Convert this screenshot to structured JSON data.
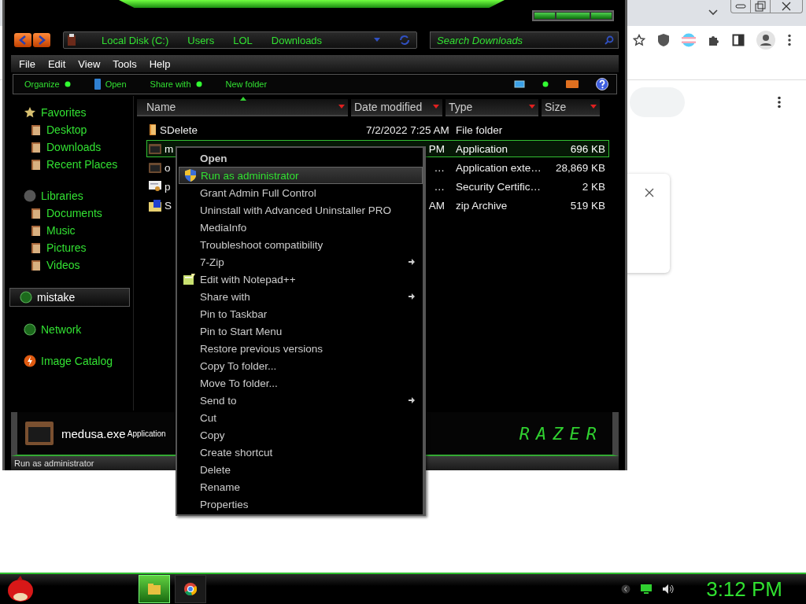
{
  "explorer": {
    "address_bar": {
      "crumbs": [
        "Local Disk (C:)",
        "Users",
        "LOL",
        "Downloads"
      ]
    },
    "search": {
      "placeholder": "Search Downloads"
    },
    "menu_bar": [
      "File",
      "Edit",
      "View",
      "Tools",
      "Help"
    ],
    "toolbar": [
      {
        "label": "Organize",
        "kind": "dropdown"
      },
      {
        "label": "Open",
        "kind": "icon"
      },
      {
        "label": "Share with",
        "kind": "dropdown"
      },
      {
        "label": "New folder",
        "kind": "plain"
      }
    ],
    "sidebar": {
      "items": [
        {
          "label": "Favorites",
          "kind": "star",
          "selected": false,
          "children": [
            {
              "label": "Desktop",
              "kind": "folder",
              "selected": false
            },
            {
              "label": "Downloads",
              "kind": "folder",
              "selected": false
            },
            {
              "label": "Recent Places",
              "kind": "folder",
              "selected": false
            }
          ]
        },
        {
          "label": "Libraries",
          "kind": "disc",
          "selected": false,
          "children": [
            {
              "label": "Documents",
              "kind": "folder",
              "selected": false
            },
            {
              "label": "Music",
              "kind": "folder",
              "selected": false
            },
            {
              "label": "Pictures",
              "kind": "folder",
              "selected": false
            },
            {
              "label": "Videos",
              "kind": "folder",
              "selected": false
            }
          ]
        },
        {
          "label": "mistake",
          "kind": "sphere",
          "selected": true
        },
        {
          "label": "Network",
          "kind": "sphere",
          "selected": false
        },
        {
          "label": "Image Catalog",
          "kind": "bolt",
          "selected": false
        }
      ]
    },
    "columns": [
      "Name",
      "Date modified",
      "Type",
      "Size"
    ],
    "rows": [
      {
        "name": "SDelete",
        "date": "7/2/2022 7:25 AM",
        "type": "File folder",
        "kind": "folder",
        "selected": false
      },
      {
        "name": "m",
        "date": "PM",
        "type": "Application",
        "size": "696 KB",
        "kind": "app",
        "selected": true
      },
      {
        "name": "o",
        "date": "…",
        "type": "Application exte…",
        "size": "28,869 KB",
        "kind": "app",
        "selected": false
      },
      {
        "name": "p",
        "date": "…",
        "type": "Security Certific…",
        "size": "2 KB",
        "kind": "cert",
        "selected": false
      },
      {
        "name": "S",
        "date": "AM",
        "type": "zip Archive",
        "size": "519 KB",
        "kind": "zip",
        "selected": false
      }
    ],
    "details": {
      "name": "medusa.exe",
      "type": "Application"
    },
    "brand": "RAZER",
    "status_bar": "Run as administrator"
  },
  "context_menu": {
    "items": [
      {
        "label": "Open",
        "kind": "default",
        "submenu": false,
        "selected": false
      },
      {
        "label": "Run as administrator",
        "kind": "elevated",
        "submenu": false,
        "selected": true
      },
      {
        "label": "Grant Admin Full Control",
        "kind": "plain",
        "submenu": false,
        "selected": false
      },
      {
        "label": "Uninstall with Advanced Uninstaller PRO",
        "kind": "plain",
        "submenu": false,
        "selected": false
      },
      {
        "label": "MediaInfo",
        "kind": "plain",
        "submenu": false,
        "selected": false
      },
      {
        "label": "Troubleshoot compatibility",
        "kind": "plain",
        "submenu": false,
        "selected": false
      },
      {
        "label": "7-Zip",
        "kind": "plain",
        "submenu": true,
        "selected": false
      },
      {
        "label": "Edit with Notepad++",
        "kind": "notepad",
        "submenu": false,
        "selected": false
      },
      {
        "label": "Share with",
        "kind": "plain",
        "submenu": true,
        "selected": false
      },
      {
        "label": "Pin to Taskbar",
        "kind": "plain",
        "submenu": false,
        "selected": false
      },
      {
        "label": "Pin to Start Menu",
        "kind": "plain",
        "submenu": false,
        "selected": false
      },
      {
        "label": "Restore previous versions",
        "kind": "plain",
        "submenu": false,
        "selected": false
      },
      {
        "label": "Copy To folder...",
        "kind": "plain",
        "submenu": false,
        "selected": false
      },
      {
        "label": "Move To folder...",
        "kind": "plain",
        "submenu": false,
        "selected": false
      },
      {
        "label": "Send to",
        "kind": "plain",
        "submenu": true,
        "selected": false
      },
      {
        "label": "Cut",
        "kind": "plain",
        "submenu": false,
        "selected": false
      },
      {
        "label": "Copy",
        "kind": "plain",
        "submenu": false,
        "selected": false
      },
      {
        "label": "Create shortcut",
        "kind": "plain",
        "submenu": false,
        "selected": false
      },
      {
        "label": "Delete",
        "kind": "plain",
        "submenu": false,
        "selected": false
      },
      {
        "label": "Rename",
        "kind": "plain",
        "submenu": false,
        "selected": false
      },
      {
        "label": "Properties",
        "kind": "plain",
        "submenu": false,
        "selected": false
      }
    ]
  },
  "taskbar": {
    "buttons": [
      {
        "kind": "folder",
        "selected": true
      },
      {
        "kind": "browser",
        "selected": false
      }
    ],
    "clock": "3:12 PM"
  }
}
